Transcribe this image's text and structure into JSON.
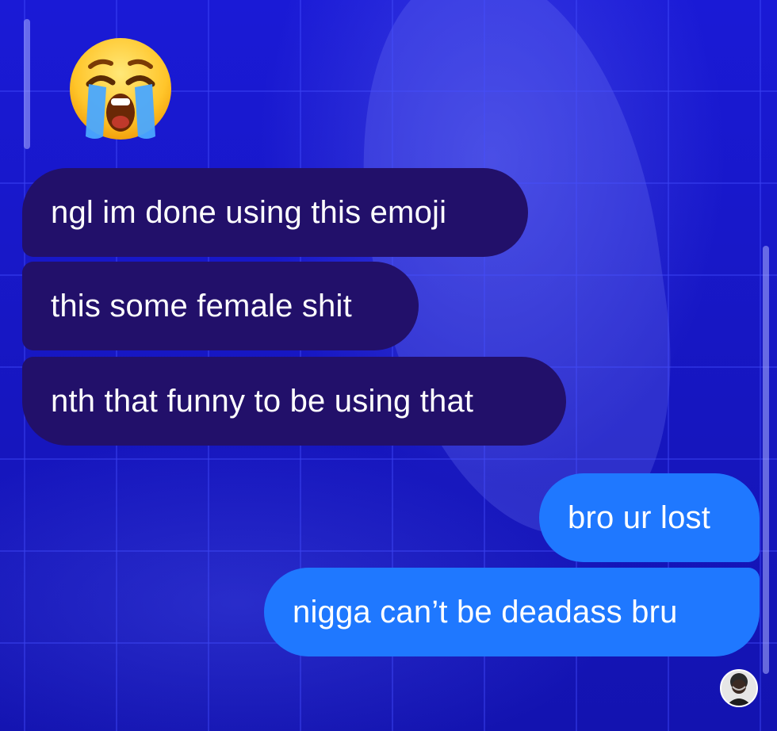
{
  "chat": {
    "reaction_emoji": {
      "icon": "loudly-crying-face-icon"
    },
    "messages": [
      {
        "side": "received",
        "text": "ngl im done using this emoji"
      },
      {
        "side": "received",
        "text": "this some female shit"
      },
      {
        "side": "received",
        "text": "nth that funny to be using that"
      },
      {
        "side": "sent",
        "text": "bro ur lost"
      },
      {
        "side": "sent",
        "text": "nigga can’t be deadass bru"
      }
    ],
    "seen_avatar": {
      "icon": "user-avatar-icon"
    }
  },
  "theme": {
    "background": "#1414c8",
    "received_bubble": "#22106a",
    "sent_bubble": "#1f78ff",
    "text": "#ffffff"
  }
}
